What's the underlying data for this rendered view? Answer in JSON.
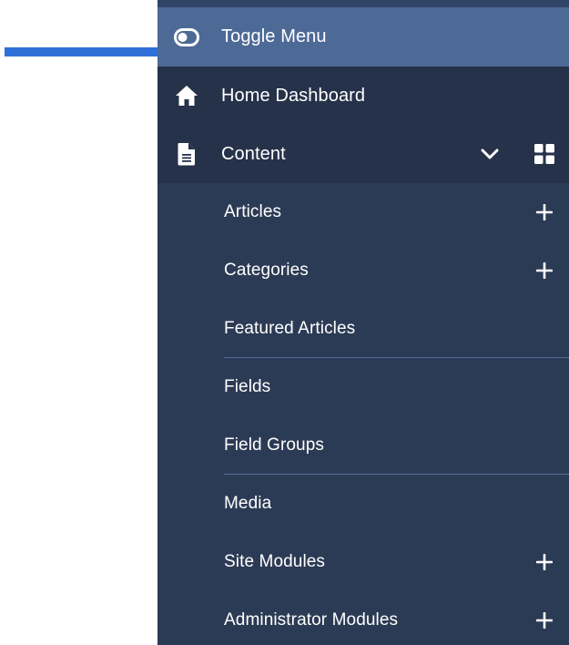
{
  "menu": {
    "toggle_label": "Toggle Menu",
    "home_label": "Home Dashboard",
    "content_label": "Content",
    "submenu": [
      {
        "label": "Articles",
        "has_add": true
      },
      {
        "label": "Categories",
        "has_add": true
      },
      {
        "label": "Featured Articles",
        "has_add": false
      },
      {
        "label": "Fields",
        "has_add": false
      },
      {
        "label": "Field Groups",
        "has_add": false
      },
      {
        "label": "Media",
        "has_add": false
      },
      {
        "label": "Site Modules",
        "has_add": true
      },
      {
        "label": "Administrator Modules",
        "has_add": true
      }
    ]
  },
  "icons": {
    "toggle": "toggle-icon",
    "home": "home-icon",
    "content": "document-icon",
    "expand": "chevron-down-icon",
    "dashboard": "grid-icon",
    "add": "plus-icon"
  },
  "colors": {
    "sidebar_bg": "#2c3b55",
    "active_bg": "#4d6a96",
    "header_bg": "#26324a",
    "pointer": "#2f6fd8",
    "text": "#ffffff"
  }
}
